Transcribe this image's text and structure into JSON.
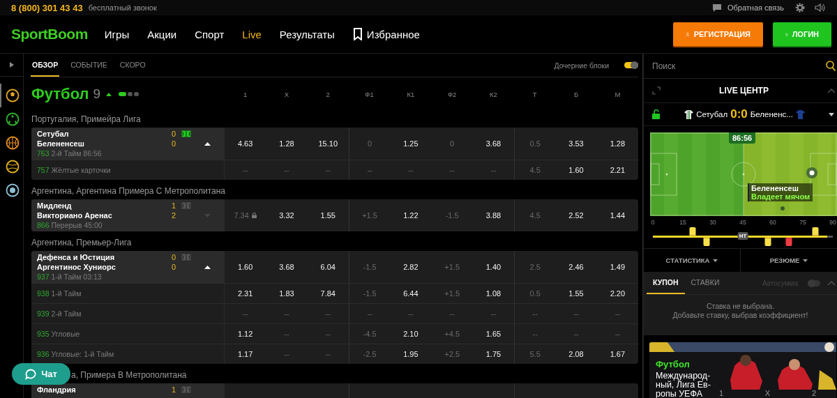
{
  "topbar": {
    "phone": "8 (800) 301 43 43",
    "phone_note": "бесплатный звонок",
    "feedback": "Обратная связь"
  },
  "nav": {
    "logo": "SportBoom",
    "items": [
      {
        "label": "Игры",
        "selected": false
      },
      {
        "label": "Акции",
        "selected": false
      },
      {
        "label": "Спорт",
        "selected": false
      },
      {
        "label": "Live",
        "selected": true
      },
      {
        "label": "Результаты",
        "selected": false
      },
      {
        "label": "Избранное",
        "selected": false,
        "kind": "bookmark"
      }
    ],
    "buttons": [
      {
        "label": "РЕГИСТРАЦИЯ",
        "kind": "register"
      },
      {
        "label": "ЛОГИН",
        "kind": "login"
      }
    ]
  },
  "rail": {
    "sports": [
      {
        "kind": "soccer",
        "color": "#e2a623",
        "selected": true
      },
      {
        "kind": "football",
        "color": "#2fb52f",
        "selected": false
      },
      {
        "kind": "basketball",
        "color": "#e08a1e",
        "selected": false
      },
      {
        "kind": "tennis",
        "color": "#e3b21f",
        "selected": false
      },
      {
        "kind": "hockey",
        "color": "#8fc1d4",
        "selected": false
      }
    ]
  },
  "tabs": [
    {
      "label": "ОБЗОР",
      "selected": true
    },
    {
      "label": "СОБЫТИЕ",
      "selected": false
    },
    {
      "label": "СКОРО",
      "selected": false
    }
  ],
  "child_blocks": {
    "label": "Дочерние блоки",
    "on": true
  },
  "section": {
    "title": "Футбол",
    "count": "9",
    "expanded": true,
    "pages": [
      {
        "selected": true
      },
      {
        "selected": false
      },
      {
        "selected": false
      }
    ],
    "columns": [
      "1",
      "X",
      "2",
      "Ф1",
      "К1",
      "Ф2",
      "К2",
      "Т",
      "Б",
      "М"
    ]
  },
  "leagues": [
    {
      "name": "Португалия, Примейра Лига",
      "obscured": false,
      "matches": [
        {
          "team1": "Сетубал",
          "team2": "Белененсеш",
          "score1": "0",
          "score2": "0",
          "tracker": true,
          "expanded": true,
          "id": "763",
          "status": "2-й Тайм 86:56",
          "odds": [
            {
              "t": "4.63",
              "on": true
            },
            {
              "t": "1.28",
              "on": true
            },
            {
              "t": "15.10",
              "on": true
            },
            {
              "t": "0",
              "on": false
            },
            {
              "t": "1.25",
              "on": true
            },
            {
              "t": "0",
              "on": false
            },
            {
              "t": "3.68",
              "on": true
            },
            {
              "t": "0.5",
              "on": false
            },
            {
              "t": "3.53",
              "on": true
            },
            {
              "t": "1.28",
              "on": true
            }
          ],
          "subrows": [
            {
              "id": "757",
              "label": "Жёлтые карточки",
              "odds": [
                {
                  "t": "--",
                  "on": false
                },
                {
                  "t": "--",
                  "on": false
                },
                {
                  "t": "--",
                  "on": false
                },
                {
                  "t": "--",
                  "on": false
                },
                {
                  "t": "--",
                  "on": false
                },
                {
                  "t": "--",
                  "on": false
                },
                {
                  "t": "--",
                  "on": false
                },
                {
                  "t": "4.5",
                  "on": false
                },
                {
                  "t": "1.60",
                  "on": true
                },
                {
                  "t": "2.21",
                  "on": true
                }
              ]
            }
          ]
        }
      ]
    },
    {
      "name": "Аргентина, Аргентина Примера С Метрополитана",
      "obscured": false,
      "matches": [
        {
          "team1": "Мидленд",
          "team2": "Викториано Аренас",
          "score1": "1",
          "score2": "2",
          "tracker": false,
          "expanded": false,
          "id": "866",
          "status": "Перерыв 45:00",
          "odds": [
            {
              "t": "7.34",
              "on": false,
              "locked": true
            },
            {
              "t": "3.32",
              "on": true
            },
            {
              "t": "1.55",
              "on": true
            },
            {
              "t": "+1.5",
              "on": false
            },
            {
              "t": "1.22",
              "on": true
            },
            {
              "t": "-1.5",
              "on": false
            },
            {
              "t": "3.88",
              "on": true
            },
            {
              "t": "4.5",
              "on": false
            },
            {
              "t": "2.52",
              "on": true
            },
            {
              "t": "1.44",
              "on": true
            }
          ]
        }
      ]
    },
    {
      "name": "Аргентина, Премьер-Лига",
      "obscured": false,
      "matches": [
        {
          "team1": "Дефенса и Юстиция",
          "team2": "Аргентинос Хуниорс",
          "score1": "0",
          "score2": "0",
          "tracker": false,
          "expanded": true,
          "id": "937",
          "status": "1-й Тайм 03:13",
          "odds": [
            {
              "t": "1.60",
              "on": true
            },
            {
              "t": "3.68",
              "on": true
            },
            {
              "t": "6.04",
              "on": true
            },
            {
              "t": "-1.5",
              "on": false
            },
            {
              "t": "2.82",
              "on": true
            },
            {
              "t": "+1.5",
              "on": false
            },
            {
              "t": "1.40",
              "on": true
            },
            {
              "t": "2.5",
              "on": false
            },
            {
              "t": "2.46",
              "on": true
            },
            {
              "t": "1.49",
              "on": true
            }
          ],
          "subrows": [
            {
              "id": "938",
              "label": "1-й Тайм",
              "odds": [
                {
                  "t": "2.31",
                  "on": true
                },
                {
                  "t": "1.83",
                  "on": true
                },
                {
                  "t": "7.84",
                  "on": true
                },
                {
                  "t": "-1.5",
                  "on": false
                },
                {
                  "t": "6.44",
                  "on": true
                },
                {
                  "t": "+1.5",
                  "on": false
                },
                {
                  "t": "1.08",
                  "on": true
                },
                {
                  "t": "0.5",
                  "on": false
                },
                {
                  "t": "1.55",
                  "on": true
                },
                {
                  "t": "2.20",
                  "on": true
                }
              ]
            },
            {
              "id": "939",
              "label": "2-й Тайм",
              "odds": [
                {
                  "t": "--",
                  "on": false
                },
                {
                  "t": "--",
                  "on": false
                },
                {
                  "t": "--",
                  "on": false
                },
                {
                  "t": "--",
                  "on": false
                },
                {
                  "t": "--",
                  "on": false
                },
                {
                  "t": "--",
                  "on": false
                },
                {
                  "t": "--",
                  "on": false
                },
                {
                  "t": "--",
                  "on": false
                },
                {
                  "t": "--",
                  "on": false
                },
                {
                  "t": "--",
                  "on": false
                }
              ]
            },
            {
              "id": "935",
              "label": "Угловые",
              "odds": [
                {
                  "t": "1.12",
                  "on": true
                },
                {
                  "t": "--",
                  "on": false
                },
                {
                  "t": "--",
                  "on": false
                },
                {
                  "t": "-4.5",
                  "on": false
                },
                {
                  "t": "2.10",
                  "on": true
                },
                {
                  "t": "+4.5",
                  "on": false
                },
                {
                  "t": "1.65",
                  "on": true
                },
                {
                  "t": "--",
                  "on": false
                },
                {
                  "t": "--",
                  "on": false
                },
                {
                  "t": "--",
                  "on": false
                }
              ]
            },
            {
              "id": "936",
              "label": "Угловые: 1-й Тайм",
              "odds": [
                {
                  "t": "1.17",
                  "on": true
                },
                {
                  "t": "--",
                  "on": false
                },
                {
                  "t": "--",
                  "on": false
                },
                {
                  "t": "-2.5",
                  "on": false
                },
                {
                  "t": "1.95",
                  "on": true
                },
                {
                  "t": "+2.5",
                  "on": false
                },
                {
                  "t": "1.75",
                  "on": true
                },
                {
                  "t": "5.5",
                  "on": false
                },
                {
                  "t": "2.08",
                  "on": true
                },
                {
                  "t": "1.67",
                  "on": true
                }
              ]
            }
          ]
        }
      ]
    },
    {
      "name": "а, Примера В Метрополитана",
      "obscured": true,
      "matches": [
        {
          "team1": "Фландрия",
          "score1": "1",
          "tracker": false
        }
      ]
    }
  ],
  "chat": {
    "label": "Чат"
  },
  "search": {
    "placeholder": "Поиск"
  },
  "live": {
    "title": "LIVE ЦЕНТР",
    "team1": "Сетубал",
    "score": "0:0",
    "team2": "Белененс..."
  },
  "pitch": {
    "time": "86:56",
    "team": "Белененсеш",
    "action": "Владеет мячом"
  },
  "timeline": {
    "ticks": [
      "0",
      "15",
      "30",
      "45",
      "60",
      "75",
      "90"
    ],
    "half": "HT",
    "level": 0.97,
    "events": [
      {
        "kind": "yellow",
        "above": true,
        "level": 0.22
      },
      {
        "kind": "yellow",
        "above": false,
        "level": 0.3
      },
      {
        "kind": "yellow",
        "above": false,
        "level": 0.64
      },
      {
        "kind": "red",
        "above": false,
        "level": 0.755
      },
      {
        "kind": "yellow",
        "above": true,
        "level": 0.905
      }
    ]
  },
  "stats_tabs": [
    "СТАТИСТИКА",
    "РЕЗЮМЕ"
  ],
  "coupon": {
    "tabs": [
      {
        "label": "КУПОН",
        "selected": true
      },
      {
        "label": "СТАВКИ",
        "selected": false
      }
    ],
    "autosum": {
      "label": "Автосумма",
      "on": false
    },
    "empty": [
      "Ставка не выбрана.",
      "Добавьте ставку, выбрав коэффициент!"
    ]
  },
  "promo": {
    "kind": "picture",
    "sport": "Футбол",
    "title": [
      "Международ-",
      "ный, Лига Ев-",
      "ропы УЕФА"
    ],
    "labels": [
      "1",
      "X",
      "2"
    ]
  }
}
